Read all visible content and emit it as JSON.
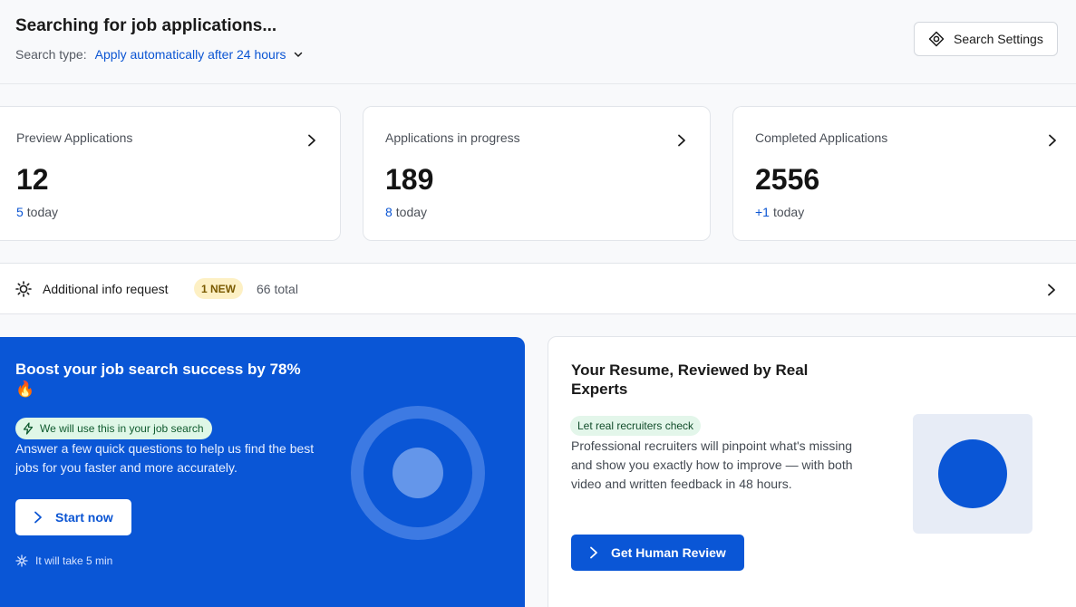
{
  "header": {
    "title": "Searching for job applications...",
    "search_type_label": "Search type:",
    "search_type_value": "Apply automatically after 24 hours",
    "settings_label": "Search Settings"
  },
  "stats": [
    {
      "label": "Preview Applications",
      "value": "12",
      "today_count": "5",
      "today_label": "today"
    },
    {
      "label": "Applications in progress",
      "value": "189",
      "today_count": "8",
      "today_label": "today"
    },
    {
      "label": "Completed Applications",
      "value": "2556",
      "today_count": "+1",
      "today_label": "today"
    }
  ],
  "info_request": {
    "title": "Additional info request",
    "badge": "1 NEW",
    "total": "66 total"
  },
  "boost": {
    "title": "Boost your job search success by 78% 🔥",
    "chip": "We will use this in your job search",
    "description": "Answer a few quick questions to help us find the best jobs for you faster and more accurately.",
    "button": "Start now",
    "time_note": "It will take 5 min"
  },
  "resume": {
    "title": "Your Resume, Reviewed by Real Experts",
    "chip": "Let real recruiters check",
    "description": "Professional recruiters will pinpoint what's missing and show you exactly how to improve — with both video and written feedback in 48 hours.",
    "button": "Get Human Review"
  },
  "colors": {
    "accent": "#0a56d6",
    "link": "#0b55d3",
    "new_badge_bg": "#fdf0c4",
    "chip_green_bg": "#dff7e7"
  }
}
